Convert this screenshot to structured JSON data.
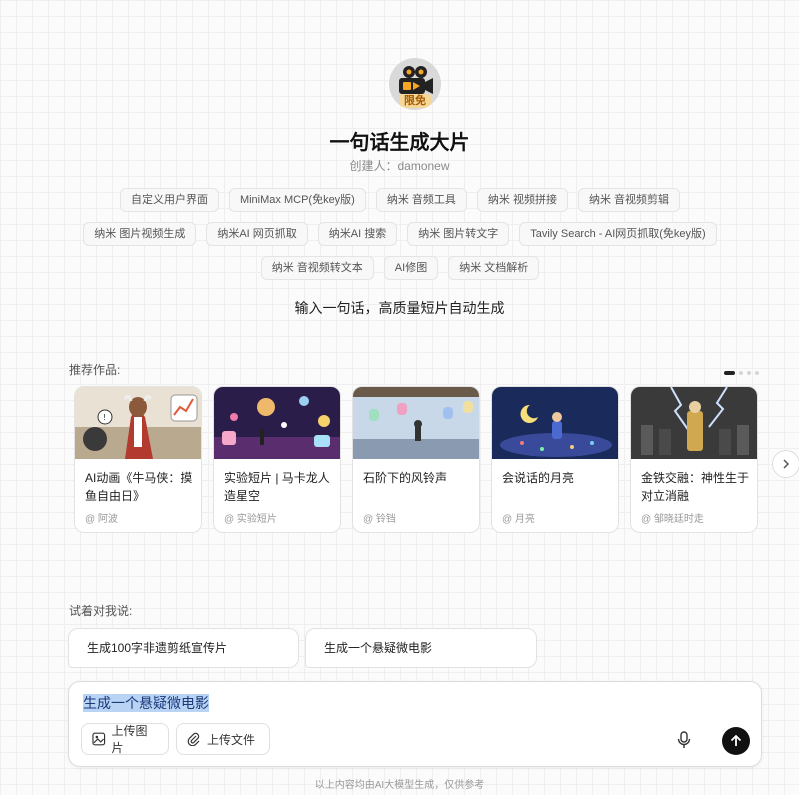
{
  "agent": {
    "badge": "限免",
    "title": "一句话生成大片",
    "creator": "创建人：damonew",
    "subtitle": "输入一句话，高质量短片自动生成"
  },
  "tags": [
    "自定义用户界面",
    "MiniMax MCP(免key版)",
    "纳米 音频工具",
    "纳米 视频拼接",
    "纳米 音视频剪辑",
    "纳米 图片视频生成",
    "纳米AI 网页抓取",
    "纳米AI 搜索",
    "纳米 图片转文字",
    "Tavily Search - AI网页抓取(免key版)",
    "纳米 音视频转文本",
    "AI修图",
    "纳米 文档解析"
  ],
  "works": {
    "label": "推荐作品:",
    "items": [
      {
        "title": "AI动画《牛马侠：摸鱼自由日》",
        "author": "@ 阿波"
      },
      {
        "title": "实验短片 | 马卡龙人造星空",
        "author": "@ 实验短片"
      },
      {
        "title": "石阶下的风铃声",
        "author": "@ 铃铛"
      },
      {
        "title": "会说话的月亮",
        "author": "@ 月亮"
      },
      {
        "title": "金铁交融：神性生于对立消融",
        "author": "@ 邹晓廷时走"
      }
    ]
  },
  "try": {
    "label": "试着对我说:",
    "items": [
      "生成100字非遗剪纸宣传片",
      "生成一个悬疑微电影"
    ]
  },
  "input": {
    "value": "生成一个悬疑微电影",
    "upload_image": "上传图片",
    "upload_file": "上传文件"
  },
  "footer": "以上内容均由AI大模型生成，仅供参考",
  "icons": {
    "next": "chevron-right-icon",
    "mic": "microphone-icon",
    "send": "arrow-up-icon",
    "image": "image-icon",
    "file": "paperclip-icon"
  },
  "colors": {
    "accent": "#111111",
    "badge": "#f6d79a",
    "selection": "#b9d3f5"
  }
}
